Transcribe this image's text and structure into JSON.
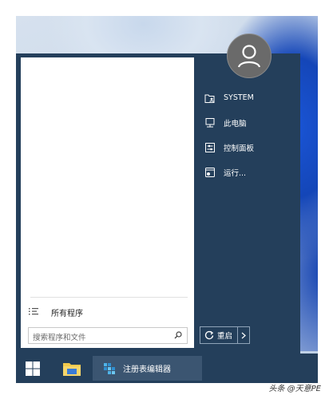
{
  "start_menu": {
    "all_programs_label": "所有程序",
    "search_placeholder": "搜索程序和文件",
    "right_items": [
      {
        "label": "SYSTEM",
        "icon": "user-folder-icon"
      },
      {
        "label": "此电脑",
        "icon": "computer-icon"
      },
      {
        "label": "控制面板",
        "icon": "control-panel-icon"
      },
      {
        "label": "运行...",
        "icon": "run-icon"
      }
    ],
    "restart_label": "重启"
  },
  "taskbar": {
    "items": [
      {
        "name": "start-button",
        "icon": "windows-logo-icon"
      },
      {
        "name": "file-explorer-button",
        "icon": "folder-icon"
      },
      {
        "name": "registry-editor-button",
        "icon": "regedit-icon",
        "label": "注册表编辑器"
      }
    ]
  },
  "watermark": "头条 @天意PE",
  "colors": {
    "menu_bg": "#243f5b",
    "taskbar_bg": "#243f5b",
    "taskbar_active": "#3b5571",
    "left_pane_bg": "#ffffff",
    "wallpaper_accent": "#1446b8"
  }
}
